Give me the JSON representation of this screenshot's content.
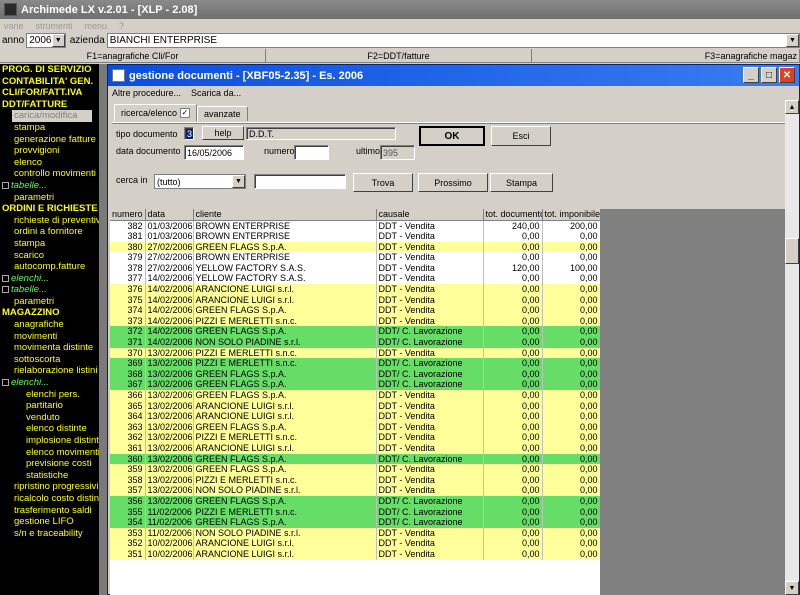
{
  "app": {
    "title": "Archimede LX v.2.01 - [XLP - 2.08]"
  },
  "menubar": [
    "varie",
    "strumenti",
    "menu",
    "?"
  ],
  "toolbar": {
    "anno_label": "anno",
    "anno_value": "2006",
    "azienda_label": "azienda",
    "azienda_value": "BIANCHI ENTERPRISE"
  },
  "fkeys": [
    "F1=anagrafiche Cli/For",
    "F2=DDT/fatture",
    "F3=anagrafiche magaz"
  ],
  "sidebar": {
    "items": [
      {
        "label": "PROG. DI SERVIZIO",
        "kind": "sec"
      },
      {
        "label": "CONTABILITA' GEN.",
        "kind": "sec"
      },
      {
        "label": "CLI/FOR/FATT.IVA",
        "kind": "sec"
      },
      {
        "label": "DDT/FATTURE",
        "kind": "sec"
      },
      {
        "label": "carica/modifica",
        "kind": "hl"
      },
      {
        "label": "stampa",
        "kind": "s1"
      },
      {
        "label": "generazione fatture",
        "kind": "s1"
      },
      {
        "label": "provvigioni",
        "kind": "s1"
      },
      {
        "label": "elenco",
        "kind": "s1"
      },
      {
        "label": "controllo movimenti",
        "kind": "s1"
      },
      {
        "label": "tabelle...",
        "kind": "tree"
      },
      {
        "label": "parametri",
        "kind": "s1"
      },
      {
        "label": "ORDINI E RICHIESTE",
        "kind": "sec"
      },
      {
        "label": "richieste di preventivo",
        "kind": "s1"
      },
      {
        "label": "ordini a fornitore",
        "kind": "s1"
      },
      {
        "label": "stampa",
        "kind": "s1"
      },
      {
        "label": "scarico",
        "kind": "s1"
      },
      {
        "label": "autocomp.fatture",
        "kind": "s1"
      },
      {
        "label": "elenchi...",
        "kind": "tree"
      },
      {
        "label": "tabelle...",
        "kind": "tree"
      },
      {
        "label": "parametri",
        "kind": "s1"
      },
      {
        "label": "MAGAZZINO",
        "kind": "sec"
      },
      {
        "label": "anagrafiche",
        "kind": "s1"
      },
      {
        "label": "movimenti",
        "kind": "s1"
      },
      {
        "label": "movimenta distinte",
        "kind": "s1"
      },
      {
        "label": "sottoscorta",
        "kind": "s1"
      },
      {
        "label": "rielaborazione listini",
        "kind": "s1"
      },
      {
        "label": "elenchi...",
        "kind": "tree"
      },
      {
        "label": "elenchi pers.",
        "kind": "s2"
      },
      {
        "label": "partitario",
        "kind": "s2"
      },
      {
        "label": "venduto",
        "kind": "s2"
      },
      {
        "label": "elenco distinte",
        "kind": "s2"
      },
      {
        "label": "implosione distinte",
        "kind": "s2"
      },
      {
        "label": "elenco movimenti",
        "kind": "s2"
      },
      {
        "label": "previsione costi",
        "kind": "s2"
      },
      {
        "label": "statistiche",
        "kind": "s2"
      },
      {
        "label": "ripristino progressivi",
        "kind": "s1"
      },
      {
        "label": "ricalcolo costo distinte",
        "kind": "s1"
      },
      {
        "label": "trasferimento saldi",
        "kind": "s1"
      },
      {
        "label": "gestione LIFO",
        "kind": "s1"
      },
      {
        "label": "s/n e traceability",
        "kind": "s1"
      }
    ]
  },
  "window": {
    "title": "gestione documenti - [XBF05-2.35] - Es. 2006",
    "menu": [
      "Altre procedure...",
      "Scarica da..."
    ],
    "tabs": [
      "ricerca/elenco",
      "avanzate"
    ],
    "form": {
      "tipo_documento_label": "tipo documento",
      "tipo_documento_value": "3",
      "help_button": "help",
      "tipo_desc": "D.D.T.",
      "data_documento_label": "data documento",
      "data_documento_value": "16/05/2006",
      "numero_label": "numero",
      "numero_value": "",
      "ultimo_label": "ultimo",
      "ultimo_value": "395",
      "ok_button": "OK",
      "esci_button": "Esci",
      "cerca_in_label": "cerca in",
      "cerca_in_value": "(tutto)",
      "cerca_value": "",
      "trova_button": "Trova",
      "prossimo_button": "Prossimo",
      "stampa_button": "Stampa"
    },
    "table": {
      "columns": [
        "numero",
        "data",
        "cliente",
        "causale",
        "tot. documento",
        "tot. imponibile"
      ],
      "rows": [
        {
          "c": "wht",
          "v": [
            "382",
            "01/03/2006",
            "BROWN ENTERPRISE",
            "DDT - Vendita",
            "240,00",
            "200,00"
          ]
        },
        {
          "c": "wht",
          "v": [
            "381",
            "01/03/2006",
            "BROWN ENTERPRISE",
            "DDT - Vendita",
            "0,00",
            "0,00"
          ]
        },
        {
          "c": "yel",
          "v": [
            "380",
            "27/02/2006",
            "GREEN FLAGS S.p.A.",
            "DDT - Vendita",
            "0,00",
            "0,00"
          ]
        },
        {
          "c": "wht",
          "v": [
            "379",
            "27/02/2006",
            "BROWN ENTERPRISE",
            "DDT - Vendita",
            "0,00",
            "0,00"
          ]
        },
        {
          "c": "wht",
          "v": [
            "378",
            "27/02/2006",
            "YELLOW FACTORY S.A.S.",
            "DDT - Vendita",
            "120,00",
            "100,00"
          ]
        },
        {
          "c": "wht",
          "v": [
            "377",
            "14/02/2006",
            "YELLOW FACTORY S.A.S.",
            "DDT - Vendita",
            "0,00",
            "0,00"
          ]
        },
        {
          "c": "yel",
          "v": [
            "376",
            "14/02/2006",
            "ARANCIONE LUIGI s.r.l.",
            "DDT - Vendita",
            "0,00",
            "0,00"
          ]
        },
        {
          "c": "yel",
          "v": [
            "375",
            "14/02/2006",
            "ARANCIONE LUIGI s.r.l.",
            "DDT - Vendita",
            "0,00",
            "0,00"
          ]
        },
        {
          "c": "yel",
          "v": [
            "374",
            "14/02/2006",
            "GREEN FLAGS S.p.A.",
            "DDT - Vendita",
            "0,00",
            "0,00"
          ]
        },
        {
          "c": "yel",
          "v": [
            "373",
            "14/02/2006",
            "PIZZI E MERLETTI s.n.c.",
            "DDT - Vendita",
            "0,00",
            "0,00"
          ]
        },
        {
          "c": "grn",
          "v": [
            "372",
            "14/02/2006",
            "GREEN FLAGS S.p.A.",
            "DDT/ C. Lavorazione",
            "0,00",
            "0,00"
          ]
        },
        {
          "c": "grn",
          "v": [
            "371",
            "14/02/2006",
            "NON SOLO PIADINE s.r.l.",
            "DDT/ C. Lavorazione",
            "0,00",
            "0,00"
          ]
        },
        {
          "c": "yel",
          "v": [
            "370",
            "13/02/2006",
            "PIZZI E MERLETTI s.n.c.",
            "DDT - Vendita",
            "0,00",
            "0,00"
          ]
        },
        {
          "c": "grn",
          "v": [
            "369",
            "13/02/2006",
            "PIZZI E MERLETTI s.n.c.",
            "DDT/ C. Lavorazione",
            "0,00",
            "0,00"
          ]
        },
        {
          "c": "grn",
          "v": [
            "368",
            "13/02/2006",
            "GREEN FLAGS S.p.A.",
            "DDT/ C. Lavorazione",
            "0,00",
            "0,00"
          ]
        },
        {
          "c": "grn",
          "v": [
            "367",
            "13/02/2006",
            "GREEN FLAGS S.p.A.",
            "DDT/ C. Lavorazione",
            "0,00",
            "0,00"
          ]
        },
        {
          "c": "yel",
          "v": [
            "366",
            "13/02/2006",
            "GREEN FLAGS S.p.A.",
            "DDT - Vendita",
            "0,00",
            "0,00"
          ]
        },
        {
          "c": "yel",
          "v": [
            "365",
            "13/02/2006",
            "ARANCIONE LUIGI s.r.l.",
            "DDT - Vendita",
            "0,00",
            "0,00"
          ]
        },
        {
          "c": "yel",
          "v": [
            "364",
            "13/02/2006",
            "ARANCIONE LUIGI s.r.l.",
            "DDT - Vendita",
            "0,00",
            "0,00"
          ]
        },
        {
          "c": "yel",
          "v": [
            "363",
            "13/02/2006",
            "GREEN FLAGS S.p.A.",
            "DDT - Vendita",
            "0,00",
            "0,00"
          ]
        },
        {
          "c": "yel",
          "v": [
            "362",
            "13/02/2006",
            "PIZZI E MERLETTI s.n.c.",
            "DDT - Vendita",
            "0,00",
            "0,00"
          ]
        },
        {
          "c": "yel",
          "v": [
            "361",
            "13/02/2006",
            "ARANCIONE LUIGI s.r.l.",
            "DDT - Vendita",
            "0,00",
            "0,00"
          ]
        },
        {
          "c": "grn",
          "v": [
            "360",
            "13/02/2006",
            "GREEN FLAGS S.p.A.",
            "DDT/ C. Lavorazione",
            "0,00",
            "0,00"
          ]
        },
        {
          "c": "yel",
          "v": [
            "359",
            "13/02/2006",
            "GREEN FLAGS S.p.A.",
            "DDT - Vendita",
            "0,00",
            "0,00"
          ]
        },
        {
          "c": "yel",
          "v": [
            "358",
            "13/02/2006",
            "PIZZI E MERLETTI s.n.c.",
            "DDT - Vendita",
            "0,00",
            "0,00"
          ]
        },
        {
          "c": "yel",
          "v": [
            "357",
            "13/02/2006",
            "NON SOLO PIADINE s.r.l.",
            "DDT - Vendita",
            "0,00",
            "0,00"
          ]
        },
        {
          "c": "grn",
          "v": [
            "356",
            "13/02/2006",
            "GREEN FLAGS S.p.A.",
            "DDT/ C. Lavorazione",
            "0,00",
            "0,00"
          ]
        },
        {
          "c": "grn",
          "v": [
            "355",
            "11/02/2006",
            "PIZZI E MERLETTI s.n.c.",
            "DDT/ C. Lavorazione",
            "0,00",
            "0,00"
          ]
        },
        {
          "c": "grn",
          "v": [
            "354",
            "11/02/2006",
            "GREEN FLAGS S.p.A.",
            "DDT/ C. Lavorazione",
            "0,00",
            "0,00"
          ]
        },
        {
          "c": "yel",
          "v": [
            "353",
            "11/02/2006",
            "NON SOLO PIADINE s.r.l.",
            "DDT - Vendita",
            "0,00",
            "0,00"
          ]
        },
        {
          "c": "yel",
          "v": [
            "352",
            "10/02/2006",
            "ARANCIONE LUIGI s.r.l.",
            "DDT - Vendita",
            "0,00",
            "0,00"
          ]
        },
        {
          "c": "yel",
          "v": [
            "351",
            "10/02/2006",
            "ARANCIONE LUIGI s.r.l.",
            "DDT - Vendita",
            "0,00",
            "0,00"
          ]
        }
      ]
    }
  }
}
